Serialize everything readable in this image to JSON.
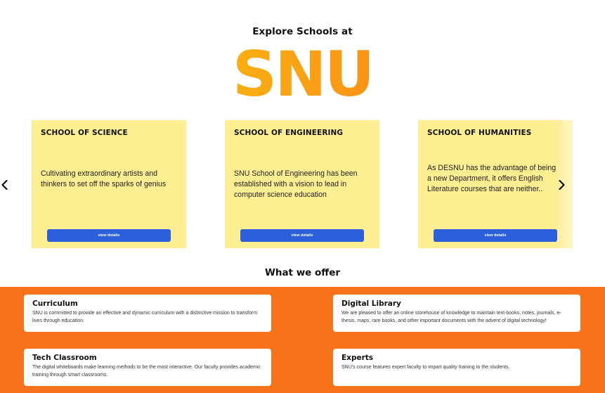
{
  "header": {
    "explore_title": "Explore Schools at",
    "brand": "SNU"
  },
  "carousel": {
    "prev_icon": "chevron-left-icon",
    "next_icon": "chevron-right-icon",
    "cards": [
      {
        "title": "SCHOOL OF SCIENCE",
        "description": "Cultivating extraordinary artists and thinkers to set off the sparks of genius",
        "button_label": "view details"
      },
      {
        "title": "SCHOOL OF ENGINEERING",
        "description": "SNU School of Engineering has been established with a vision to lead in computer science education",
        "button_label": "view details"
      },
      {
        "title": "SCHOOL OF HUMANITIES",
        "description": "As DESNU has the advantage of being a new Department, it offers English Literature courses that are neither..",
        "button_label": "view details"
      }
    ]
  },
  "offer": {
    "heading": "What we offer",
    "items": [
      {
        "title": "Curriculum",
        "text": "SNU is committed to provide an effective and dynamic curriculum with a distinctive mission to transform lives through education."
      },
      {
        "title": "Digital Library",
        "text": "We are pleased to offer an online storehouse of knowledge to maintain text-books, notes, journals, e-thesis, maps, rare books, and other important documents with the advent of digital technology!"
      },
      {
        "title": "Tech Classroom",
        "text": "The digital whiteboards make learning methods to be the most interactive. Our faculty provides academic training through smart classrooms."
      },
      {
        "title": "Experts",
        "text": "SNU's course features expert faculty to impart quality training to the students."
      }
    ]
  },
  "colors": {
    "card_yellow": "#fcee91",
    "button_blue": "#2b5fdc",
    "offer_orange": "#f7731a",
    "brand_gradient_start": "#f9c514",
    "brand_gradient_end": "#f6751b"
  }
}
